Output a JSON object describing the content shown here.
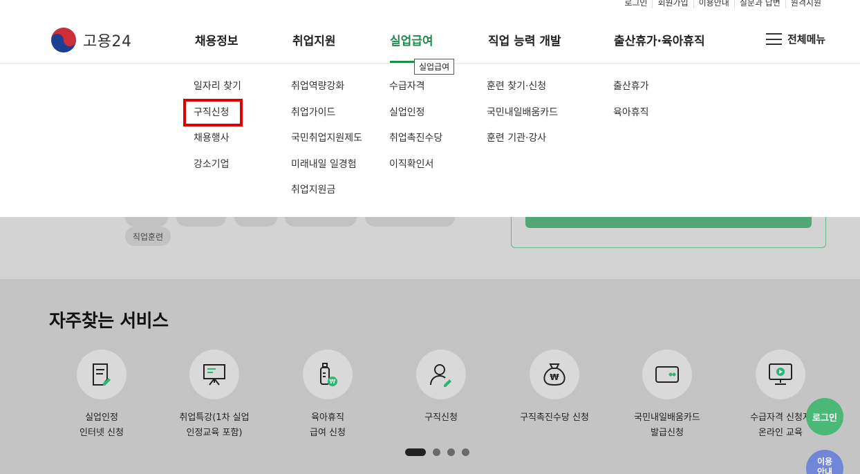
{
  "utility": [
    "로그인",
    "회원가입",
    "이용안내",
    "질문과 답변",
    "원격지원"
  ],
  "logo": {
    "text": "고용24"
  },
  "gnb": [
    {
      "label": "채용정보",
      "active": false
    },
    {
      "label": "취업지원",
      "active": false
    },
    {
      "label": "실업급여",
      "active": true
    },
    {
      "label": "직업 능력 개발",
      "active": false
    },
    {
      "label": "출산휴가·육아휴직",
      "active": false
    }
  ],
  "allmenu": {
    "label": "전체메뉴",
    "icon": "hamburger-icon"
  },
  "tooltip": "실업급여",
  "mega_menu": [
    {
      "items": [
        "일자리 찾기",
        "구직신청",
        "채용행사",
        "강소기업"
      ]
    },
    {
      "items": [
        "취업역량강화",
        "취업가이드",
        "국민취업지원제도",
        "미래내일 일경험",
        "취업지원금"
      ]
    },
    {
      "items": [
        "수급자격",
        "실업인정",
        "취업촉진수당",
        "이직확인서"
      ]
    },
    {
      "items": [
        "훈련 찾기·신청",
        "국민내일배움카드",
        "훈련 기관·강사"
      ]
    },
    {
      "items": [
        "출산휴가",
        "육아휴직"
      ]
    }
  ],
  "highlighted_item": "구직신청",
  "background": {
    "tag": "직업훈련",
    "services_title": "자주찾는 서비스",
    "services": [
      {
        "label": "실업인정\n인터넷 신청",
        "icon": "document-edit-icon"
      },
      {
        "label": "취업특강(1차 실업\n인정교육 포함)",
        "icon": "presentation-board-icon"
      },
      {
        "label": "육아휴직\n급여 신청",
        "icon": "baby-bottle-won-icon"
      },
      {
        "label": "구직신청",
        "icon": "person-edit-icon"
      },
      {
        "label": "구직촉진수당 신청",
        "icon": "money-bag-won-icon"
      },
      {
        "label": "국민내일배움카드\n발급신청",
        "icon": "card-icon"
      },
      {
        "label": "수급자격 신청자\n온라인 교육",
        "icon": "monitor-play-icon"
      }
    ],
    "carousel_pages": 4,
    "carousel_active": 1
  },
  "fab": {
    "login": "로그인",
    "guide": "이용\n안내"
  },
  "colors": {
    "brand_green": "#1e8a4e",
    "highlight_red": "#e00000",
    "login_fab": "#4cb877",
    "guide_fab": "#6f87d6"
  }
}
